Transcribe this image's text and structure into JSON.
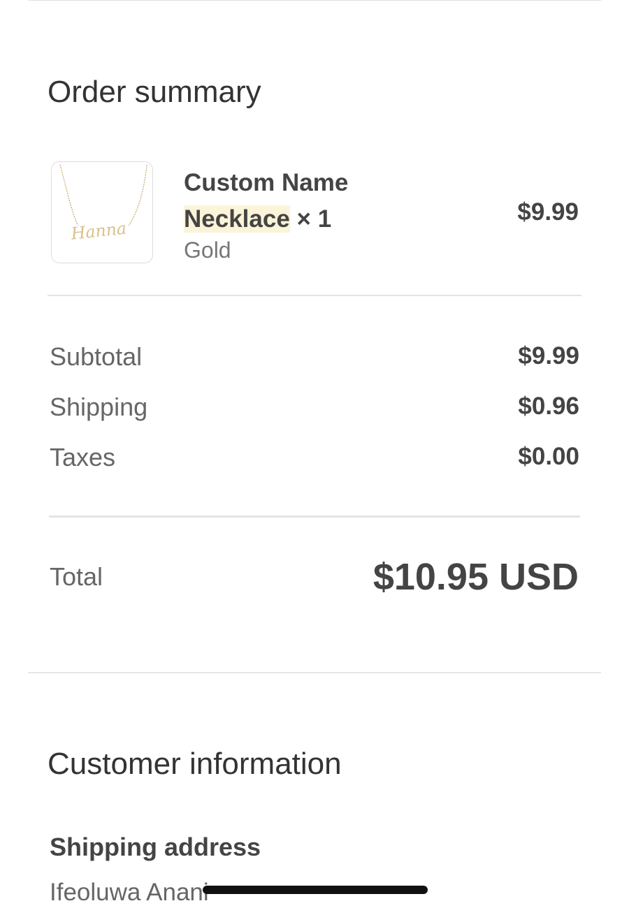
{
  "order_summary": {
    "title": "Order summary",
    "item": {
      "name_line1": "Custom Name",
      "name_line2": "Necklace",
      "quantity": "× 1",
      "variant": "Gold",
      "price": "$9.99",
      "thumbnail_icon": "necklace-image"
    },
    "costs": {
      "subtotal_label": "Subtotal",
      "subtotal_value": "$9.99",
      "shipping_label": "Shipping",
      "shipping_value": "$0.96",
      "taxes_label": "Taxes",
      "taxes_value": "$0.00"
    },
    "total": {
      "label": "Total",
      "value": "$10.95 USD"
    }
  },
  "customer_information": {
    "title": "Customer information",
    "shipping_address_heading": "Shipping address",
    "name": "Ifeoluwa Anani"
  },
  "colors": {
    "text_dark": "#444444",
    "text_muted": "#666666",
    "highlight": "#fbf4d8",
    "divider": "#e4e4e4"
  }
}
